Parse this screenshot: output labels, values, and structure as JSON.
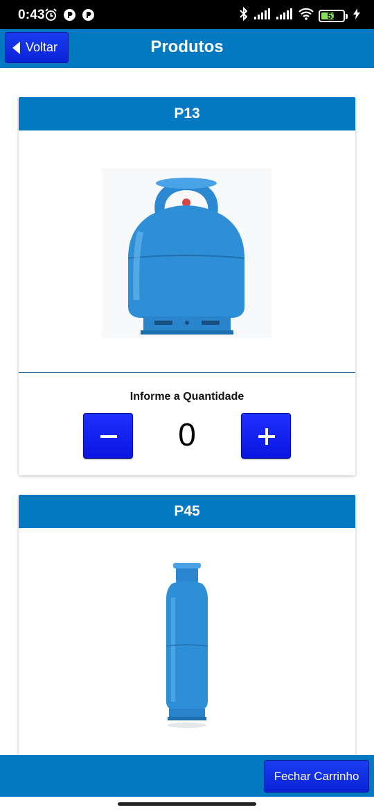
{
  "status_bar": {
    "time": "0:43",
    "battery_level": "51",
    "icons": [
      "alarm-icon",
      "app-notification-icon",
      "app-notification-icon",
      "bluetooth-icon",
      "signal-icon",
      "signal-icon",
      "wifi-icon",
      "battery-icon",
      "charging-icon"
    ]
  },
  "header": {
    "back_label": "Voltar",
    "title": "Produtos"
  },
  "products": [
    {
      "name": "P13",
      "image": "gas-cylinder-p13",
      "quantity_label": "Informe a Quantidade",
      "quantity": "0"
    },
    {
      "name": "P45",
      "image": "gas-cylinder-p45"
    }
  ],
  "footer": {
    "checkout_label": "Fechar Carrinho"
  },
  "colors": {
    "primary": "#0379c2",
    "button": "#0a22d8",
    "cylinder": "#2f8fd6"
  }
}
